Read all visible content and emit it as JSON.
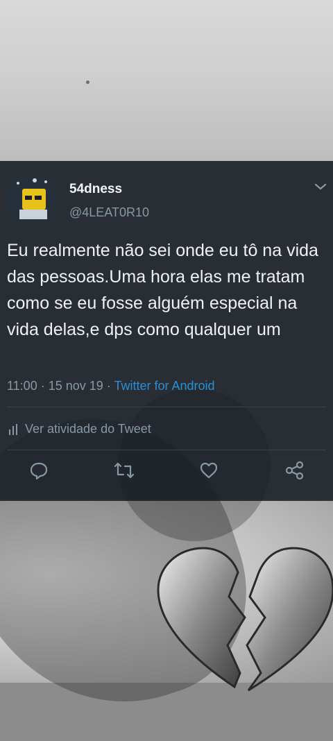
{
  "tweet": {
    "display_name": "54dness",
    "handle": "@4LEAT0R10",
    "text": "Eu realmente não sei onde eu tô na vida das pessoas.Uma hora elas me tratam como se eu fosse alguém especial na vida delas,e dps como qualquer um",
    "time": "11:00",
    "date": "15 nov 19",
    "source": "Twitter for Android",
    "separator": " · ",
    "activity_label": "Ver atividade do Tweet"
  },
  "icons": {
    "avatar": "cartoon-avatar",
    "menu": "chevron-down-icon",
    "activity": "bar-chart-icon",
    "reply": "reply-icon",
    "retweet": "retweet-icon",
    "like": "heart-icon",
    "share": "share-icon",
    "background": "broken-heart"
  },
  "colors": {
    "card_bg": "#181e26",
    "text": "#eef2f5",
    "muted": "#8899a6",
    "link": "#2b8fd6"
  }
}
